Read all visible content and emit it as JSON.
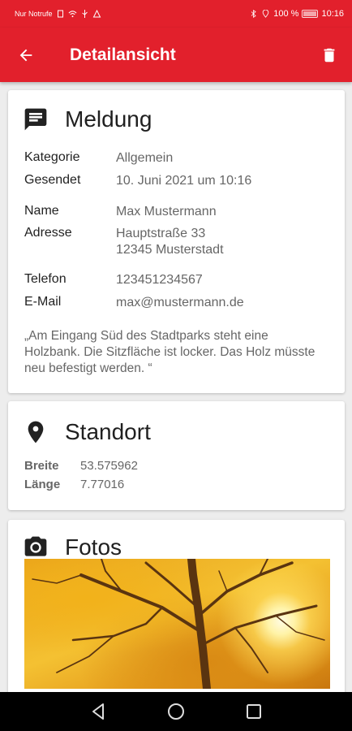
{
  "status_bar": {
    "carrier": "Nur Notrufe",
    "battery": "100 %",
    "time": "10:16"
  },
  "app_bar": {
    "title": "Detailansicht",
    "back_icon": "arrow-back-icon",
    "delete_icon": "trash-icon"
  },
  "report": {
    "title": "Meldung",
    "icon": "message-icon",
    "fields": [
      {
        "label": "Kategorie",
        "value": "Allgemein"
      },
      {
        "label": "Gesendet",
        "value": "10. Juni 2021 um 10:16"
      },
      {
        "label": "Name",
        "value": "Max Mustermann"
      },
      {
        "label": "Adresse",
        "value": "Hauptstraße 33\n12345 Musterstadt"
      },
      {
        "label": "Telefon",
        "value": "123451234567"
      },
      {
        "label": "E-Mail",
        "value": "max@mustermann.de"
      }
    ],
    "message": "„Am Eingang Süd des Stadtparks steht eine Holzbank. Die Sitzfläche ist locker. Das Holz müsste neu befestigt werden. “"
  },
  "location": {
    "title": "Standort",
    "icon": "location-pin-icon",
    "latitude_label": "Breite",
    "latitude": "53.575962",
    "longitude_label": "Länge",
    "longitude": "7.77016"
  },
  "photos": {
    "title": "Fotos",
    "icon": "camera-icon"
  },
  "colors": {
    "brand": "#e2202c",
    "background": "#ededed"
  }
}
